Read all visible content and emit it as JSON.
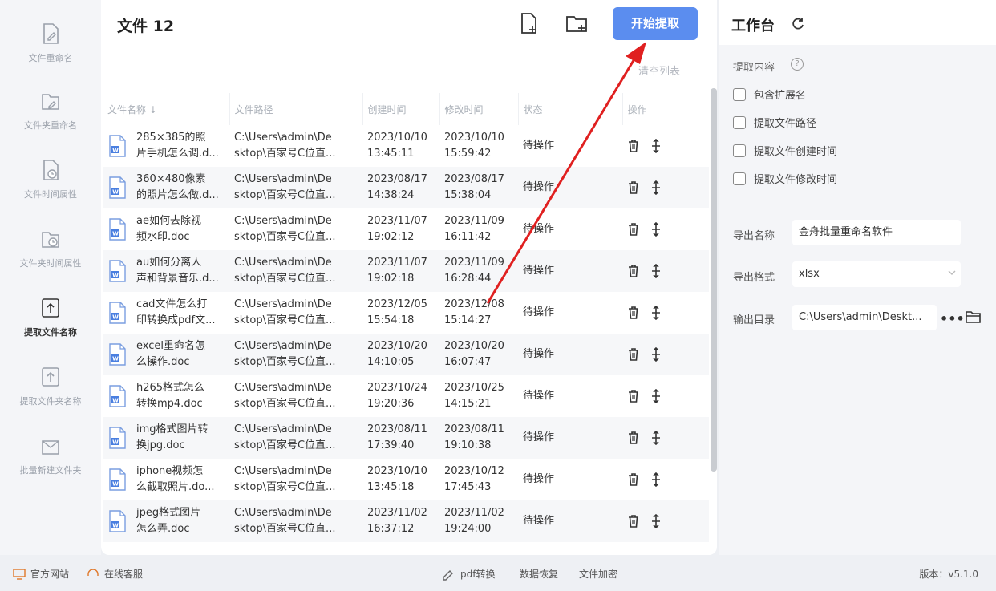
{
  "sidebar": {
    "items": [
      {
        "label": "文件重命名",
        "icon": "file-edit-icon",
        "active": false
      },
      {
        "label": "文件夹重命名",
        "icon": "folder-edit-icon",
        "active": false
      },
      {
        "label": "文件时间属性",
        "icon": "file-clock-icon",
        "active": false
      },
      {
        "label": "文件夹时间属性",
        "icon": "folder-clock-icon",
        "active": false
      },
      {
        "label": "提取文件名称",
        "icon": "file-extract-icon",
        "active": true
      },
      {
        "label": "提取文件夹名称",
        "icon": "folder-extract-icon",
        "active": false
      },
      {
        "label": "批量新建文件夹",
        "icon": "folder-new-icon",
        "active": false
      }
    ]
  },
  "main": {
    "title": "文件 12",
    "start_label": "开始提取",
    "clear_label": "清空列表",
    "columns": [
      "文件名称 ↓",
      "文件路径",
      "创建时间",
      "修改时间",
      "状态",
      "操作"
    ],
    "rows": [
      {
        "name1": "285×385的照",
        "name2": "片手机怎么调.d...",
        "path1": "C:\\Users\\admin\\De",
        "path2": "sktop\\百家号C位直...",
        "c1": "2023/10/10",
        "c2": "13:45:11",
        "m1": "2023/10/10",
        "m2": "15:59:42",
        "status": "待操作"
      },
      {
        "name1": "360×480像素",
        "name2": "的照片怎么做.d...",
        "path1": "C:\\Users\\admin\\De",
        "path2": "sktop\\百家号C位直...",
        "c1": "2023/08/17",
        "c2": "14:38:24",
        "m1": "2023/08/17",
        "m2": "15:38:04",
        "status": "待操作"
      },
      {
        "name1": "ae如何去除视",
        "name2": "频水印.doc",
        "path1": "C:\\Users\\admin\\De",
        "path2": "sktop\\百家号C位直...",
        "c1": "2023/11/07",
        "c2": "19:02:12",
        "m1": "2023/11/09",
        "m2": "16:11:42",
        "status": "待操作"
      },
      {
        "name1": "au如何分离人",
        "name2": "声和背景音乐.d...",
        "path1": "C:\\Users\\admin\\De",
        "path2": "sktop\\百家号C位直...",
        "c1": "2023/11/07",
        "c2": "19:02:18",
        "m1": "2023/11/09",
        "m2": "16:28:44",
        "status": "待操作"
      },
      {
        "name1": "cad文件怎么打",
        "name2": "印转换成pdf文...",
        "path1": "C:\\Users\\admin\\De",
        "path2": "sktop\\百家号C位直...",
        "c1": "2023/12/05",
        "c2": "15:54:18",
        "m1": "2023/12/08",
        "m2": "15:14:27",
        "status": "待操作"
      },
      {
        "name1": "excel重命名怎",
        "name2": "么操作.doc",
        "path1": "C:\\Users\\admin\\De",
        "path2": "sktop\\百家号C位直...",
        "c1": "2023/10/20",
        "c2": "14:10:05",
        "m1": "2023/10/20",
        "m2": "16:07:47",
        "status": "待操作"
      },
      {
        "name1": "h265格式怎么",
        "name2": "转换mp4.doc",
        "path1": "C:\\Users\\admin\\De",
        "path2": "sktop\\百家号C位直...",
        "c1": "2023/10/24",
        "c2": "19:20:36",
        "m1": "2023/10/25",
        "m2": "14:15:21",
        "status": "待操作"
      },
      {
        "name1": "img格式图片转",
        "name2": "换jpg.doc",
        "path1": "C:\\Users\\admin\\De",
        "path2": "sktop\\百家号C位直...",
        "c1": "2023/08/11",
        "c2": "17:39:40",
        "m1": "2023/08/11",
        "m2": "19:10:38",
        "status": "待操作"
      },
      {
        "name1": "iphone视频怎",
        "name2": "么截取照片.do...",
        "path1": "C:\\Users\\admin\\De",
        "path2": "sktop\\百家号C位直...",
        "c1": "2023/10/10",
        "c2": "13:45:18",
        "m1": "2023/10/12",
        "m2": "17:45:43",
        "status": "待操作"
      },
      {
        "name1": "jpeg格式图片",
        "name2": "怎么弄.doc",
        "path1": "C:\\Users\\admin\\De",
        "path2": "sktop\\百家号C位直...",
        "c1": "2023/11/02",
        "c2": "16:37:12",
        "m1": "2023/11/02",
        "m2": "19:24:00",
        "status": "待操作"
      }
    ]
  },
  "workbench": {
    "title": "工作台",
    "content_label": "提取内容",
    "help": "?",
    "checkboxes": [
      "包含扩展名",
      "提取文件路径",
      "提取文件创建时间",
      "提取文件修改时间"
    ],
    "export_name_label": "导出名称",
    "export_name_value": "金舟批量重命名软件",
    "export_format_label": "导出格式",
    "export_format_value": "xlsx",
    "output_dir_label": "输出目录",
    "output_dir_value": "C:\\Users\\admin\\Deskt...",
    "more": "•••"
  },
  "footer": {
    "website": "官方网站",
    "support": "在线客服",
    "pdf": "pdf转换",
    "recovery": "数据恢复",
    "encrypt": "文件加密",
    "version": "版本：v5.1.0"
  },
  "colors": {
    "accent": "#5b8def",
    "annotation": "#e02020"
  }
}
